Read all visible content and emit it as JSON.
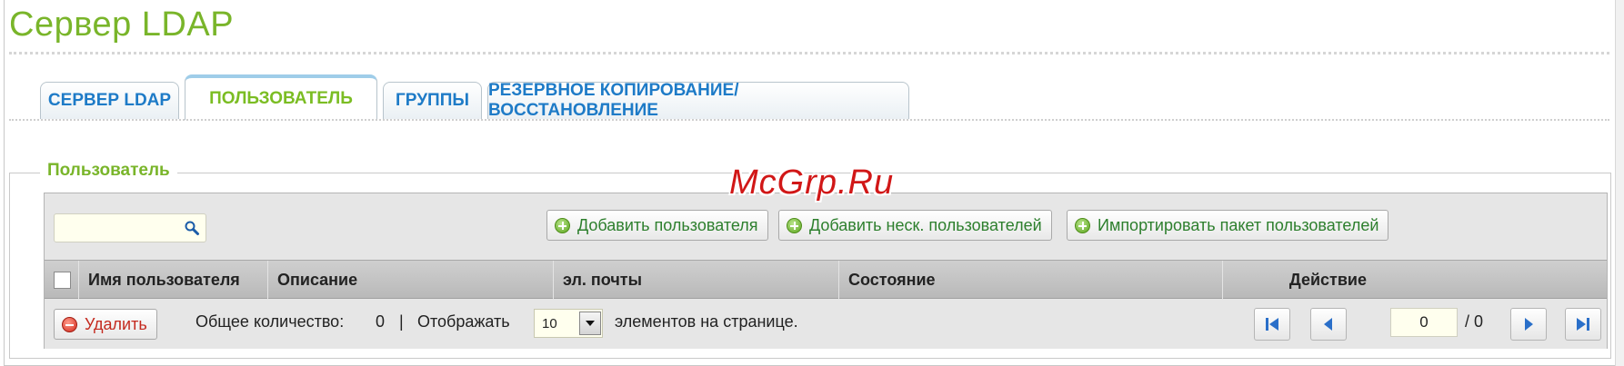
{
  "page": {
    "title": "Сервер LDAP"
  },
  "tabs": [
    {
      "label": "СЕРВЕР LDAP",
      "active": false
    },
    {
      "label": "ПОЛЬЗОВАТЕЛЬ",
      "active": true
    },
    {
      "label": "ГРУППЫ",
      "active": false
    },
    {
      "label": "РЕЗЕРВНОЕ КОПИРОВАНИЕ/ВОССТАНОВЛЕНИЕ",
      "active": false
    }
  ],
  "section": {
    "legend": "Пользователь"
  },
  "toolbar": {
    "search_value": "",
    "add_user": "Добавить пользователя",
    "add_multiple": "Добавить неск. пользователей",
    "import_batch": "Импортировать пакет пользователей"
  },
  "table": {
    "columns": [
      "Имя пользователя",
      "Описание",
      "эл. почты",
      "Состояние",
      "Действие"
    ]
  },
  "footer": {
    "delete_label": "Удалить",
    "total_label": "Общее количество:",
    "total_value": "0",
    "separator": "|",
    "show_label": "Отображать",
    "per_page_value": "10",
    "per_page_suffix": "элементов на странице.",
    "current_page": "0",
    "total_pages": "/ 0"
  },
  "watermark": "McGrp.Ru",
  "colors": {
    "accent_green": "#79b52a",
    "tab_blue": "#1e7bc7",
    "delete_red": "#c42a1f"
  }
}
